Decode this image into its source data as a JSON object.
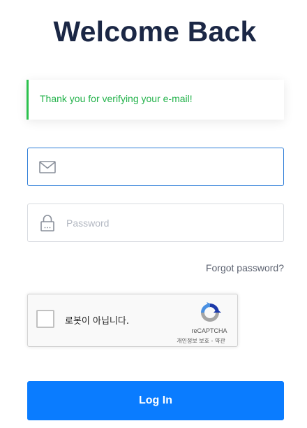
{
  "page": {
    "title": "Welcome Back"
  },
  "alert": {
    "message": "Thank you for verifying your e-mail!",
    "color": "#22b24a"
  },
  "form": {
    "email": {
      "value": "",
      "icon": "envelope-icon"
    },
    "password": {
      "placeholder": "Password",
      "icon": "padlock-icon"
    },
    "forgot_password": "Forgot password?",
    "login_button": "Log In",
    "accent_color": "#0a7cff"
  },
  "recaptcha": {
    "label": "로봇이 아닙니다.",
    "brand": "reCAPTCHA",
    "privacy": "개인정보 보호",
    "separator": " - ",
    "terms": "약관"
  }
}
